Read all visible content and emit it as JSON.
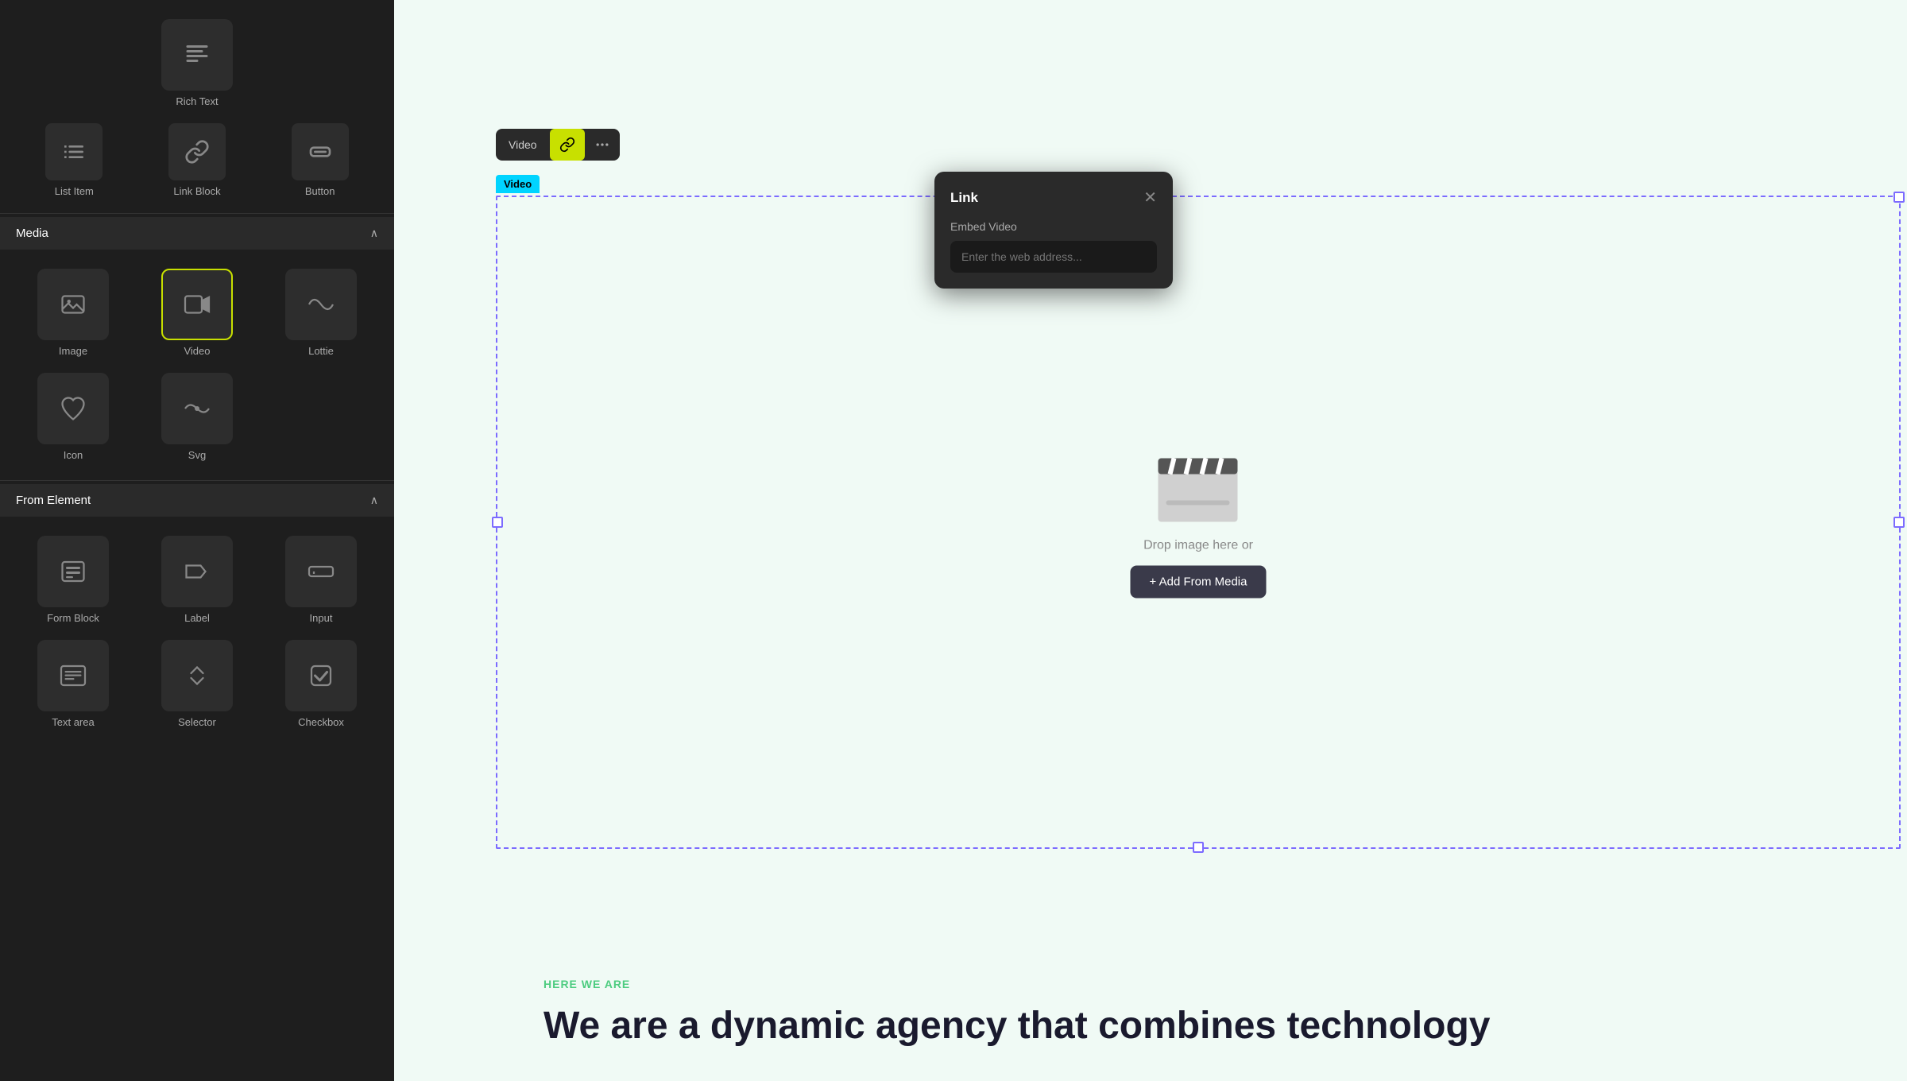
{
  "sidebar": {
    "top_items": [
      {
        "id": "list-item",
        "label": "List Item"
      },
      {
        "id": "link-block",
        "label": "Link Block"
      },
      {
        "id": "button",
        "label": "Button"
      }
    ],
    "rich_text": {
      "label": "Rich Text"
    },
    "media_section": {
      "title": "Media",
      "items": [
        {
          "id": "image",
          "label": "Image"
        },
        {
          "id": "video",
          "label": "Video",
          "selected": true
        },
        {
          "id": "lottie",
          "label": "Lottie"
        },
        {
          "id": "icon",
          "label": "Icon"
        },
        {
          "id": "svg",
          "label": "Svg"
        }
      ]
    },
    "from_element_section": {
      "title": "From Element",
      "items": [
        {
          "id": "form-block",
          "label": "Form Block"
        },
        {
          "id": "label",
          "label": "Label"
        },
        {
          "id": "input",
          "label": "Input"
        },
        {
          "id": "text-area",
          "label": "Text area"
        },
        {
          "id": "selector",
          "label": "Selector"
        },
        {
          "id": "checkbox",
          "label": "Checkbox"
        }
      ]
    }
  },
  "toolbar": {
    "label": "Video",
    "link_btn_label": "link",
    "more_btn_label": "more"
  },
  "video_tab_label": "Video",
  "link_popup": {
    "title": "Link",
    "subtitle": "Embed Video",
    "input_placeholder": "Enter the web address..."
  },
  "video_area": {
    "drop_text": "Drop image here or",
    "add_button": "+ Add From Media"
  },
  "bottom_section": {
    "tag": "HERE WE ARE",
    "headline": "We are a dynamic agency that combines technology"
  }
}
